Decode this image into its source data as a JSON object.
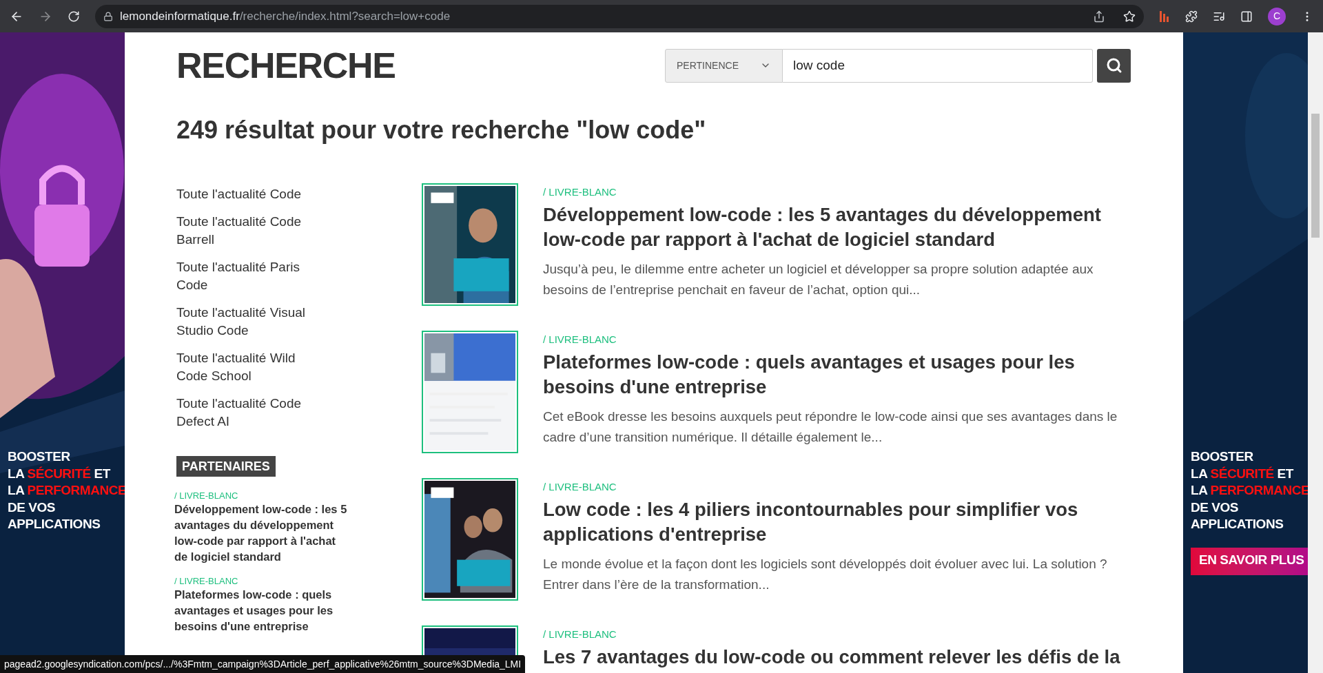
{
  "browser": {
    "url_host": "lemondeinformatique.fr",
    "url_path": "/recherche/index.html?search=low+code",
    "profile_initial": "C",
    "forward_disabled": true
  },
  "page": {
    "heading": "RECHERCHE",
    "sort_select": "PERTINENCE",
    "search_value": "low code",
    "results_heading": "249 résultat pour votre recherche \"low code\"",
    "topic_links": [
      "Toute l'actualité Code",
      "Toute l'actualité Code Barrell",
      "Toute l'actualité Paris Code",
      "Toute l'actualité Visual Studio Code",
      "Toute l'actualité Wild Code School",
      "Toute l'actualité Code Defect AI"
    ],
    "partners_label": "PARTENAIRES",
    "partners": [
      {
        "category": "/ LIVRE-BLANC",
        "title": "Développement low-code : les 5 avantages du développement low-code par rapport à l'achat de logiciel standard"
      },
      {
        "category": "/ LIVRE-BLANC",
        "title": "Plateformes low-code : quels avantages et usages pour les besoins d'une entreprise"
      }
    ],
    "results": [
      {
        "category": "/ LIVRE-BLANC",
        "title": "Développement low-code : les 5 avantages du développement low-code par rapport à l'achat de logiciel standard",
        "excerpt": "Jusqu’à peu, le dilemme entre acheter un logiciel et développer sa propre solution adaptée aux besoins de l’entreprise penchait en faveur de l’achat, option qui..."
      },
      {
        "category": "/ LIVRE-BLANC",
        "title": "Plateformes low-code : quels avantages et usages pour les besoins d'une entreprise",
        "excerpt": "Cet eBook dresse les besoins auxquels peut répondre le low-code ainsi que ses avantages dans le cadre d’une transition numérique. Il détaille également le..."
      },
      {
        "category": "/ LIVRE-BLANC",
        "title": "Low code : les 4 piliers incontournables pour simplifier vos applications d'entreprise",
        "excerpt": "Le monde évolue et la façon dont les logiciels sont développés doit évoluer avec lui. La solution ? Entrer dans l’ère de la transformation..."
      },
      {
        "category": "/ LIVRE-BLANC",
        "title": "Les 7 avantages du low-code ou comment relever les défis de la"
      }
    ]
  },
  "ads": [
    {
      "lines": [
        [
          {
            "text": "BOOSTER",
            "accent": false
          }
        ],
        [
          {
            "text": "LA ",
            "accent": false
          },
          {
            "text": "SÉCURITÉ",
            "accent": true
          },
          {
            "text": " ET",
            "accent": false
          }
        ],
        [
          {
            "text": "LA ",
            "accent": false
          },
          {
            "text": "PERFORMANCE",
            "accent": true
          }
        ],
        [
          {
            "text": "DE VOS",
            "accent": false
          }
        ],
        [
          {
            "text": "APPLICATIONS",
            "accent": false
          }
        ]
      ]
    },
    {
      "lines": [
        [
          {
            "text": "BOOSTER",
            "accent": false
          }
        ],
        [
          {
            "text": "LA ",
            "accent": false
          },
          {
            "text": "SÉCURITÉ",
            "accent": true
          },
          {
            "text": " ET",
            "accent": false
          }
        ],
        [
          {
            "text": "LA ",
            "accent": false
          },
          {
            "text": "PERFORMANCE",
            "accent": true
          }
        ],
        [
          {
            "text": "DE VOS",
            "accent": false
          }
        ],
        [
          {
            "text": "APPLICATIONS",
            "accent": false
          }
        ]
      ],
      "cta": "EN SAVOIR PLUS"
    }
  ],
  "status_bar": "pagead2.googlesyndication.com/pcs/.../%3Fmtm_campaign%3DArticle_perf_applicative%26mtm_source%3DMedia_LMI"
}
